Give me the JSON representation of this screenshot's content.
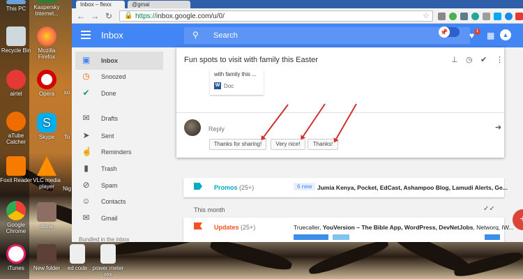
{
  "desktop": {
    "icons": [
      {
        "label": "This PC",
        "color": "#6aa1d8"
      },
      {
        "label": "Recycle Bin",
        "color": "#cfd8dc"
      },
      {
        "label": "airtel",
        "color": "#e53935"
      },
      {
        "label": "aTube Catcher",
        "color": "#ef6c00"
      },
      {
        "label": "Foxit Reader",
        "color": "#f57c00"
      },
      {
        "label": "Google Chrome",
        "color": "#34a853"
      },
      {
        "label": "iTunes",
        "color": "#e91e63"
      },
      {
        "label": "Kaspersky Internet...",
        "color": "#2e7d32"
      },
      {
        "label": "Mozilla Firefox",
        "color": "#ff7043"
      },
      {
        "label": "Opera",
        "color": "#d50000"
      },
      {
        "label": "Skype",
        "color": "#00aff0"
      },
      {
        "label": "VLC media player",
        "color": "#ff8f00"
      },
      {
        "label": "dona",
        "color": "#8d6e63"
      },
      {
        "label": "New folder",
        "color": "#5d4037"
      },
      {
        "label": "ed code",
        "color": "#eeeeee"
      },
      {
        "label": "power meter rex",
        "color": "#eeeeee"
      },
      {
        "label": "so",
        "color": "#8d6e63"
      },
      {
        "label": "To",
        "color": "#8d6e63"
      },
      {
        "label": "Nig",
        "color": "#8d6e63"
      }
    ]
  },
  "browser": {
    "tabs": [
      {
        "label": "Inbox – flexx"
      },
      {
        "label": "@gmai"
      }
    ],
    "url_protocol": "https://",
    "url_rest": "inbox.google.com/u/0/",
    "nav_icons": [
      "back-icon",
      "forward-icon",
      "reload-icon"
    ]
  },
  "appbar": {
    "menu_icon": "hamburger-icon",
    "title": "Inbox",
    "search_placeholder": "Search",
    "pin_icon": "pin-icon",
    "notification_count": "1",
    "accent": "#4285f4"
  },
  "sidebar": {
    "items": [
      {
        "label": "Inbox",
        "icon": "inbox-icon",
        "active": true
      },
      {
        "label": "Snoozed",
        "icon": "clock-icon",
        "active": false
      },
      {
        "label": "Done",
        "icon": "check-icon",
        "active": false
      },
      {
        "label": "Drafts",
        "icon": "drafts-icon",
        "active": false
      },
      {
        "label": "Sent",
        "icon": "send-icon",
        "active": false
      },
      {
        "label": "Reminders",
        "icon": "reminder-icon",
        "active": false
      },
      {
        "label": "Trash",
        "icon": "trash-icon",
        "active": false
      },
      {
        "label": "Spam",
        "icon": "spam-icon",
        "active": false
      },
      {
        "label": "Contacts",
        "icon": "contacts-icon",
        "active": false
      },
      {
        "label": "Gmail",
        "icon": "gmail-icon",
        "active": false
      }
    ],
    "bundled_label": "Bundled in the inbox"
  },
  "message": {
    "subject": "Fun spots to visit with family this Easter",
    "attachment_title": "with family this ...",
    "attachment_type": "Doc",
    "reply_label": "Reply",
    "smart_replies": [
      "Thanks for sharing!",
      "Very nice!",
      "Thanks!"
    ]
  },
  "bundles": [
    {
      "name": "Promos",
      "count": "(25+)",
      "badge": "6 new",
      "snippet_bold": "Jumia Kenya, Pocket, EdCast, Ashampoo Blog, Lamudi Alerts, Ge...",
      "color": "#00acc1"
    },
    {
      "section": "This month"
    },
    {
      "name": "Updates",
      "count": "(25+)",
      "badge": "",
      "snippet_plain": "Truecaller, ",
      "snippet_bold": "YouVersion – The Bible App, WordPress, DevNetJobs",
      "snippet_tail": ", Networq, IW...",
      "color": "#f4511e"
    }
  ]
}
